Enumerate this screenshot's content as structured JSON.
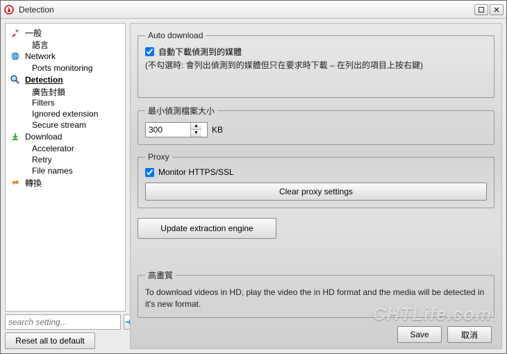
{
  "window": {
    "title": "Detection"
  },
  "sidebar": {
    "items": [
      {
        "label": "一般",
        "icon": "tools"
      },
      {
        "label": "語言",
        "child": true
      },
      {
        "label": "Network",
        "icon": "globe"
      },
      {
        "label": "Ports monitoring",
        "child": true
      },
      {
        "label": "Detection",
        "icon": "search",
        "selected": true
      },
      {
        "label": "廣告封鎖",
        "child": true
      },
      {
        "label": "Filters",
        "child": true
      },
      {
        "label": "Ignored extension",
        "child": true
      },
      {
        "label": "Secure stream",
        "child": true
      },
      {
        "label": "Download",
        "icon": "download"
      },
      {
        "label": "Accelerator",
        "child": true
      },
      {
        "label": "Retry",
        "child": true
      },
      {
        "label": "File names",
        "child": true
      },
      {
        "label": "轉換",
        "icon": "convert"
      }
    ],
    "search_placeholder": "search setting...",
    "reset_label": "Reset all to default"
  },
  "auto_download": {
    "legend": "Auto download",
    "checkbox_label": "自動下載偵測到的媒體",
    "checked": true,
    "note": "(不勾選時: 會列出偵測到的媒體但只在要求時下載 – 在列出的項目上按右鍵)"
  },
  "min_size": {
    "legend": "最小偵測檔案大小",
    "value": "300",
    "unit": "KB"
  },
  "proxy": {
    "legend": "Proxy",
    "checkbox_label": "Monitor HTTPS/SSL",
    "checked": true,
    "clear_label": "Clear proxy settings"
  },
  "update_label": "Update extraction engine",
  "hq": {
    "legend": "高畫質",
    "text": "To download videos in HD, play the video the in HD format and the media will be detected in it's new format."
  },
  "footer": {
    "save": "Save",
    "cancel": "取消"
  },
  "watermark": "CHTLife.com"
}
